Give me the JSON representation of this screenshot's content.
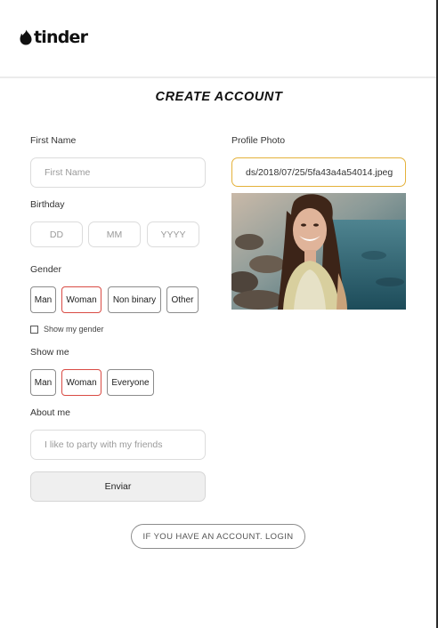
{
  "brand": {
    "logo_text": "tinder",
    "logo_icon": "flame-icon",
    "accent": "#d94b44"
  },
  "page": {
    "title": "CREATE ACCOUNT"
  },
  "form": {
    "first_name": {
      "label": "First Name",
      "placeholder": "First Name",
      "value": ""
    },
    "birthday": {
      "label": "Birthday",
      "day_placeholder": "DD",
      "month_placeholder": "MM",
      "year_placeholder": "YYYY"
    },
    "gender": {
      "label": "Gender",
      "options": [
        "Man",
        "Woman",
        "Non binary",
        "Other"
      ],
      "selected": "Woman",
      "show_gender_label": "Show my gender",
      "show_gender_checked": false
    },
    "show_me": {
      "label": "Show me",
      "options": [
        "Man",
        "Woman",
        "Everyone"
      ],
      "selected": "Woman"
    },
    "about_me": {
      "label": "About me",
      "placeholder": "I like to party with my friends"
    },
    "submit_label": "Enviar"
  },
  "profile_photo": {
    "label": "Profile Photo",
    "url_value": "ds/2018/07/25/5fa43a4a54014.jpeg",
    "input_border_color": "#e4b13a"
  },
  "footer": {
    "login_label": "IF YOU HAVE AN ACCOUNT. LOGIN"
  }
}
